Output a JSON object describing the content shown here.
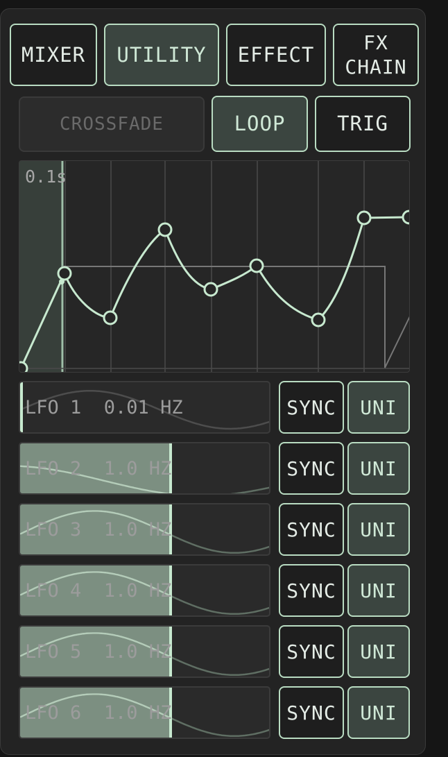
{
  "tabs": [
    {
      "label": "MIXER",
      "active": false
    },
    {
      "label": "UTILITY",
      "active": true
    },
    {
      "label": "EFFECT",
      "active": false
    },
    {
      "label": "FX\nCHAIN",
      "active": false
    }
  ],
  "modes": [
    {
      "label": "CROSSFADE",
      "state": "disabled"
    },
    {
      "label": "LOOP",
      "state": "active"
    },
    {
      "label": "TRIG",
      "state": "normal"
    }
  ],
  "envelope": {
    "time_label": "0.1s"
  },
  "lfos": [
    {
      "label": "LFO 1  0.01 HZ",
      "level": 0.0,
      "sync": "SYNC",
      "uni": "UNI"
    },
    {
      "label": "LFO 2  1.0 HZ",
      "level": 0.6,
      "sync": "SYNC",
      "uni": "UNI"
    },
    {
      "label": "LFO 3  1.0 HZ",
      "level": 0.6,
      "sync": "SYNC",
      "uni": "UNI"
    },
    {
      "label": "LFO 4  1.0 HZ",
      "level": 0.6,
      "sync": "SYNC",
      "uni": "UNI"
    },
    {
      "label": "LFO 5  1.0 HZ",
      "level": 0.6,
      "sync": "SYNC",
      "uni": "UNI"
    },
    {
      "label": "LFO 6  1.0 HZ",
      "level": 0.6,
      "sync": "SYNC",
      "uni": "UNI"
    }
  ],
  "colors": {
    "accent": "#b9dcc2",
    "fill": "#7c8f81",
    "panel": "#232323"
  }
}
